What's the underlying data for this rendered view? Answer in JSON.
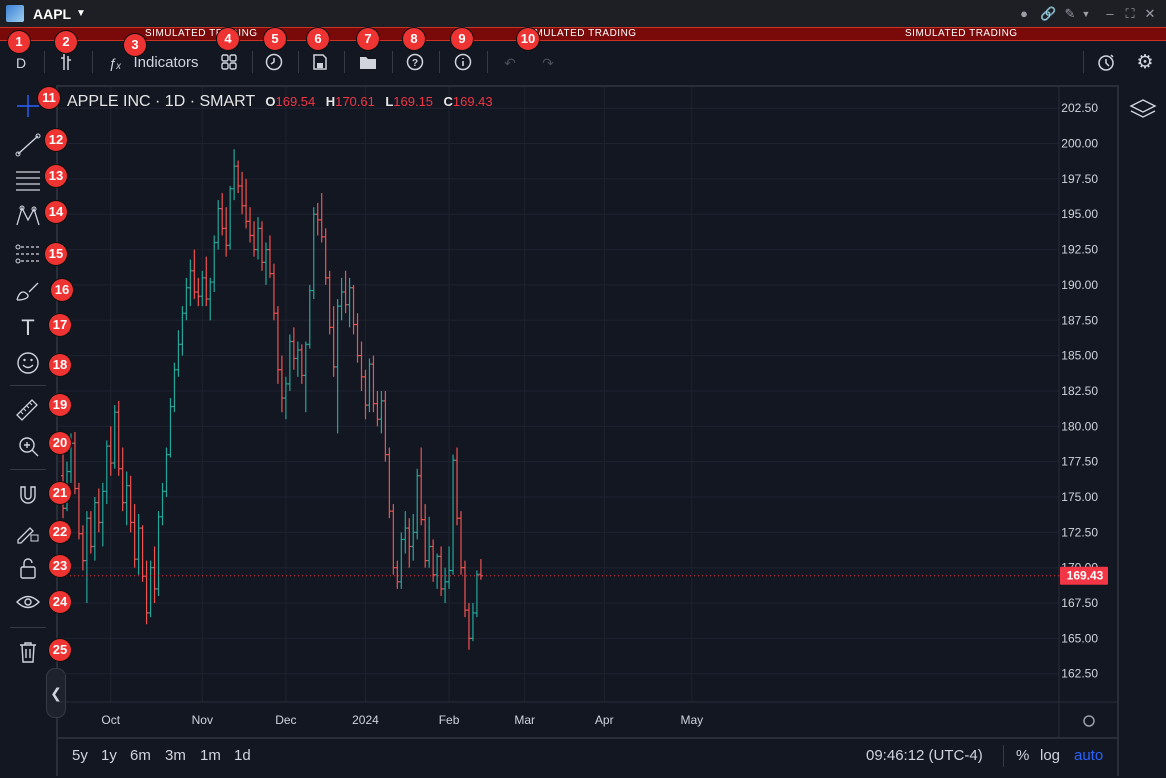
{
  "titlebar": {
    "symbol": "AAPL"
  },
  "sim_banner": [
    "SIMULATED TRADING",
    "SIMULATED TRADING",
    "SIMULATED TRADING"
  ],
  "toolbar": {
    "interval": "D",
    "indicators_label": "Indicators"
  },
  "legend": {
    "title": "APPLE INC · 1D · SMART",
    "o_label": "O",
    "o": "169.54",
    "h_label": "H",
    "h": "170.61",
    "l_label": "L",
    "l": "169.15",
    "c_label": "C",
    "c": "169.43"
  },
  "badges": [
    "1",
    "2",
    "3",
    "4",
    "5",
    "6",
    "7",
    "8",
    "9",
    "10",
    "11",
    "12",
    "13",
    "14",
    "15",
    "16",
    "17",
    "18",
    "19",
    "20",
    "21",
    "22",
    "23",
    "24",
    "25"
  ],
  "bottom": {
    "timeframes": [
      "5y",
      "1y",
      "6m",
      "3m",
      "1m",
      "1d"
    ],
    "clock": "09:46:12 (UTC-4)",
    "percent": "%",
    "log": "log",
    "auto": "auto"
  },
  "colors": {
    "up": "#26a69a",
    "down": "#ef5350",
    "background": "#131722",
    "price_tag": "#f23645",
    "accent": "#2962ff"
  },
  "icons": [
    "crosshair-icon",
    "trend-line-icon",
    "horizontal-lines-icon",
    "pattern-icon",
    "fib-icon",
    "brush-icon",
    "text-icon",
    "emoji-icon",
    "ruler-icon",
    "zoom-in-icon",
    "magnet-icon",
    "lock-drawing-icon",
    "unlock-icon",
    "eye-icon",
    "trash-icon",
    "layers-icon",
    "settings-icon",
    "undo-icon",
    "redo-icon"
  ],
  "chart_data": {
    "type": "ohlc",
    "price_label": "169.43",
    "y_ticks": [
      "202.50",
      "200.00",
      "197.50",
      "195.00",
      "192.50",
      "190.00",
      "187.50",
      "185.00",
      "182.50",
      "180.00",
      "177.50",
      "175.00",
      "172.50",
      "170.00",
      "167.50",
      "165.00",
      "162.50"
    ],
    "ylim": [
      160.5,
      204
    ],
    "x_ticks": [
      {
        "label": "Oct",
        "bar": 12
      },
      {
        "label": "Nov",
        "bar": 35
      },
      {
        "label": "Dec",
        "bar": 56
      },
      {
        "label": "2024",
        "bar": 76
      },
      {
        "label": "Feb",
        "bar": 97
      },
      {
        "label": "Mar",
        "bar": 116
      },
      {
        "label": "Apr",
        "bar": 136
      },
      {
        "label": "May",
        "bar": 158
      }
    ],
    "series": [
      {
        "values": [
          [
            176.5,
            179.0,
            173.5,
            174.2
          ],
          [
            174.2,
            177.5,
            174.0,
            176.8
          ],
          [
            176.8,
            179.5,
            176.0,
            178.8
          ],
          [
            178.8,
            179.6,
            175.2,
            175.6
          ],
          [
            175.6,
            176.0,
            172.0,
            172.4
          ],
          [
            172.4,
            173.0,
            169.8,
            170.5
          ],
          [
            170.5,
            174.0,
            167.5,
            173.5
          ],
          [
            173.5,
            174.0,
            171.0,
            171.5
          ],
          [
            171.5,
            175.0,
            170.5,
            174.6
          ],
          [
            174.6,
            175.6,
            172.5,
            173.2
          ],
          [
            173.2,
            176.0,
            171.5,
            175.4
          ],
          [
            175.4,
            179.0,
            174.5,
            178.6
          ],
          [
            178.6,
            180.0,
            176.5,
            177.4
          ],
          [
            177.4,
            181.5,
            177.0,
            181.0
          ],
          [
            181.0,
            181.8,
            176.5,
            177.0
          ],
          [
            177.0,
            178.5,
            174.0,
            174.6
          ],
          [
            174.6,
            176.8,
            173.0,
            175.8
          ],
          [
            175.8,
            176.5,
            172.5,
            173.2
          ],
          [
            173.2,
            174.5,
            170.0,
            170.6
          ],
          [
            170.6,
            173.8,
            169.5,
            172.8
          ],
          [
            172.8,
            173.0,
            169.0,
            169.4
          ],
          [
            169.4,
            170.5,
            166.0,
            166.8
          ],
          [
            166.8,
            170.5,
            166.5,
            170.0
          ],
          [
            170.0,
            171.5,
            167.5,
            168.5
          ],
          [
            168.5,
            174.0,
            168.0,
            173.6
          ],
          [
            173.6,
            176.0,
            173.0,
            175.4
          ],
          [
            175.4,
            178.5,
            175.0,
            178.0
          ],
          [
            178.0,
            182.0,
            177.8,
            181.4
          ],
          [
            181.4,
            184.5,
            181.0,
            184.0
          ],
          [
            184.0,
            186.8,
            183.5,
            185.8
          ],
          [
            185.8,
            188.5,
            185.0,
            188.0
          ],
          [
            188.0,
            190.5,
            187.5,
            189.8
          ],
          [
            189.8,
            191.8,
            188.5,
            191.0
          ],
          [
            191.0,
            192.5,
            189.0,
            189.5
          ],
          [
            189.5,
            190.5,
            188.5,
            189.2
          ],
          [
            189.2,
            191.0,
            188.5,
            190.5
          ],
          [
            190.5,
            192.0,
            188.5,
            189.0
          ],
          [
            189.0,
            190.5,
            187.5,
            190.2
          ],
          [
            190.2,
            193.5,
            189.5,
            193.0
          ],
          [
            193.0,
            196.0,
            192.5,
            195.4
          ],
          [
            195.4,
            196.5,
            193.5,
            194.0
          ],
          [
            194.0,
            195.5,
            192.0,
            192.8
          ],
          [
            192.8,
            197.0,
            192.5,
            196.8
          ],
          [
            196.8,
            199.6,
            196.0,
            198.4
          ],
          [
            198.4,
            198.8,
            196.5,
            197.0
          ],
          [
            197.0,
            198.0,
            195.0,
            195.6
          ],
          [
            195.6,
            197.5,
            194.0,
            194.5
          ],
          [
            194.5,
            195.5,
            193.0,
            193.5
          ],
          [
            193.5,
            194.5,
            192.0,
            192.5
          ],
          [
            192.5,
            194.8,
            191.8,
            194.0
          ],
          [
            194.0,
            194.5,
            191.0,
            191.6
          ],
          [
            191.6,
            193.0,
            190.0,
            192.5
          ],
          [
            192.5,
            193.5,
            190.5,
            190.8
          ],
          [
            190.8,
            191.5,
            187.5,
            188.0
          ],
          [
            188.0,
            188.5,
            183.0,
            184.0
          ],
          [
            184.0,
            185.0,
            181.0,
            182.0
          ],
          [
            182.0,
            183.5,
            180.5,
            183.0
          ],
          [
            183.0,
            186.5,
            182.5,
            186.0
          ],
          [
            186.0,
            187.0,
            184.0,
            184.8
          ],
          [
            184.8,
            186.0,
            183.5,
            185.4
          ],
          [
            185.4,
            185.8,
            183.0,
            183.6
          ],
          [
            183.6,
            186.0,
            181.0,
            185.8
          ],
          [
            185.8,
            190.0,
            185.5,
            189.6
          ],
          [
            189.6,
            195.5,
            189.0,
            195.0
          ],
          [
            195.0,
            195.8,
            193.5,
            194.6
          ],
          [
            194.6,
            196.5,
            193.0,
            193.4
          ],
          [
            193.4,
            194.0,
            190.0,
            190.5
          ],
          [
            190.5,
            191.0,
            186.5,
            187.0
          ],
          [
            187.0,
            188.5,
            183.5,
            184.2
          ],
          [
            184.2,
            189.0,
            179.5,
            188.5
          ],
          [
            188.5,
            190.5,
            187.5,
            189.5
          ],
          [
            189.5,
            191.0,
            188.0,
            188.6
          ],
          [
            188.6,
            190.5,
            187.0,
            189.8
          ],
          [
            189.8,
            190.0,
            186.5,
            187.2
          ],
          [
            187.2,
            188.0,
            184.5,
            185.0
          ],
          [
            185.0,
            186.0,
            182.5,
            183.5
          ],
          [
            183.5,
            184.0,
            180.5,
            181.5
          ],
          [
            181.5,
            184.8,
            181.0,
            184.4
          ],
          [
            184.4,
            185.0,
            181.0,
            181.6
          ],
          [
            181.6,
            182.5,
            180.0,
            180.5
          ],
          [
            180.5,
            182.5,
            179.5,
            181.8
          ],
          [
            181.8,
            182.5,
            177.5,
            178.0
          ],
          [
            178.0,
            178.5,
            173.5,
            174.0
          ],
          [
            174.0,
            174.5,
            169.5,
            170.0
          ],
          [
            170.0,
            170.5,
            168.5,
            169.0
          ],
          [
            169.0,
            172.5,
            168.5,
            172.0
          ],
          [
            172.0,
            174.0,
            171.0,
            172.8
          ],
          [
            172.8,
            173.5,
            170.0,
            171.5
          ],
          [
            171.5,
            173.8,
            170.5,
            172.5
          ],
          [
            172.5,
            177.0,
            172.0,
            176.5
          ],
          [
            176.5,
            178.5,
            173.0,
            173.4
          ],
          [
            173.4,
            174.5,
            170.0,
            170.5
          ],
          [
            170.5,
            173.6,
            170.0,
            171.5
          ],
          [
            171.5,
            172.0,
            169.0,
            169.5
          ],
          [
            169.5,
            171.0,
            168.5,
            170.8
          ],
          [
            170.8,
            171.5,
            168.0,
            168.5
          ],
          [
            168.5,
            170.0,
            167.5,
            169.0
          ],
          [
            169.0,
            171.5,
            168.5,
            169.8
          ],
          [
            169.8,
            178.0,
            169.5,
            177.6
          ],
          [
            177.6,
            178.5,
            173.0,
            173.5
          ],
          [
            173.5,
            174.0,
            169.5,
            170.0
          ],
          [
            170.0,
            170.5,
            166.5,
            167.0
          ],
          [
            167.0,
            167.5,
            164.2,
            165.0
          ],
          [
            165.0,
            167.5,
            164.8,
            166.8
          ],
          [
            166.8,
            169.8,
            166.5,
            169.5
          ],
          [
            169.54,
            170.61,
            169.15,
            169.43
          ]
        ]
      }
    ]
  }
}
